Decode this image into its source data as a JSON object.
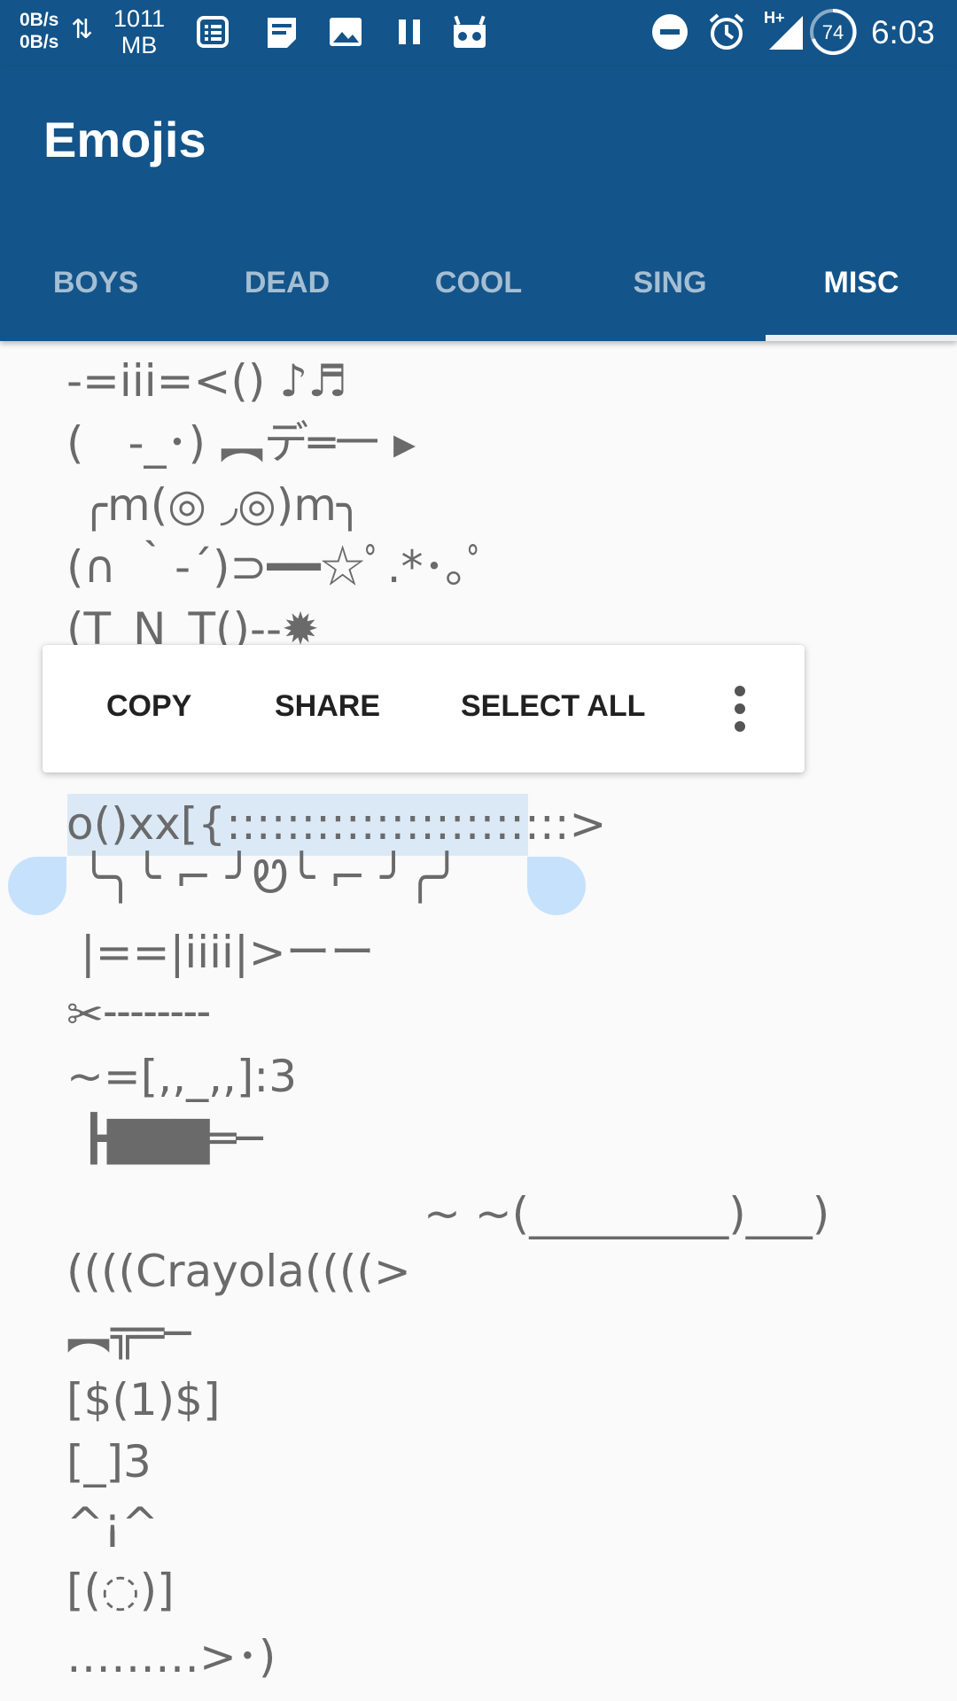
{
  "status_bar": {
    "net_up": "0B/s",
    "net_down": "0B/s",
    "arrows": "⇅",
    "memory_value": "1011",
    "memory_unit": "MB",
    "network_type": "H+",
    "battery": "74",
    "time": "6:03",
    "icons": [
      "notes-icon",
      "message-icon",
      "image-icon",
      "pause-icon",
      "android-icon",
      "dnd-icon",
      "alarm-icon",
      "signal-icon",
      "battery-icon"
    ]
  },
  "app_bar": {
    "title": "Emojis"
  },
  "tabs": [
    {
      "label": "BOYS",
      "active": false
    },
    {
      "label": "DEAD",
      "active": false
    },
    {
      "label": "COOL",
      "active": false
    },
    {
      "label": "SING",
      "active": false
    },
    {
      "label": "MISC",
      "active": true
    }
  ],
  "text_toolbar": {
    "copy": "COPY",
    "share": "SHARE",
    "select_all": "SELECT ALL",
    "more_icon": "more-vert-icon"
  },
  "emojis": [
    "-=iii=<() ♪♬",
    "(　-_･) ︻デ═一 ▸",
    " ╭m(◎ ◞◎)m╮",
    "(∩ ｀-´)⊃━━☆ﾟ.*･｡ﾟ",
    "(T_N_T()--✹",
    "o()xx[{:::::::::::::::::::::::>",
    " ╰╮╰ ⌐ ╯Ꮼ╰ ⌐ ╯╭╯",
    " |==|iiii|>ーー",
    "✂╌╌╌╌",
    "~=[,,_,,]:3",
    " ┣▇▇▇═─",
    "~ ~(_________)___)",
    "((((Crayola((((>",
    "︻╦═─",
    "[$(1)$]",
    "[_]3",
    "^¡^",
    "[(◌)]",
    "………>･)"
  ],
  "selected_text": "o()xx[{:::::::::::::::::::::::>",
  "colors": {
    "primary": "#13548a",
    "background": "#fafafa",
    "text": "#6a6a6a",
    "selection": "#dbe9f7",
    "handle": "#c6e1fb"
  }
}
